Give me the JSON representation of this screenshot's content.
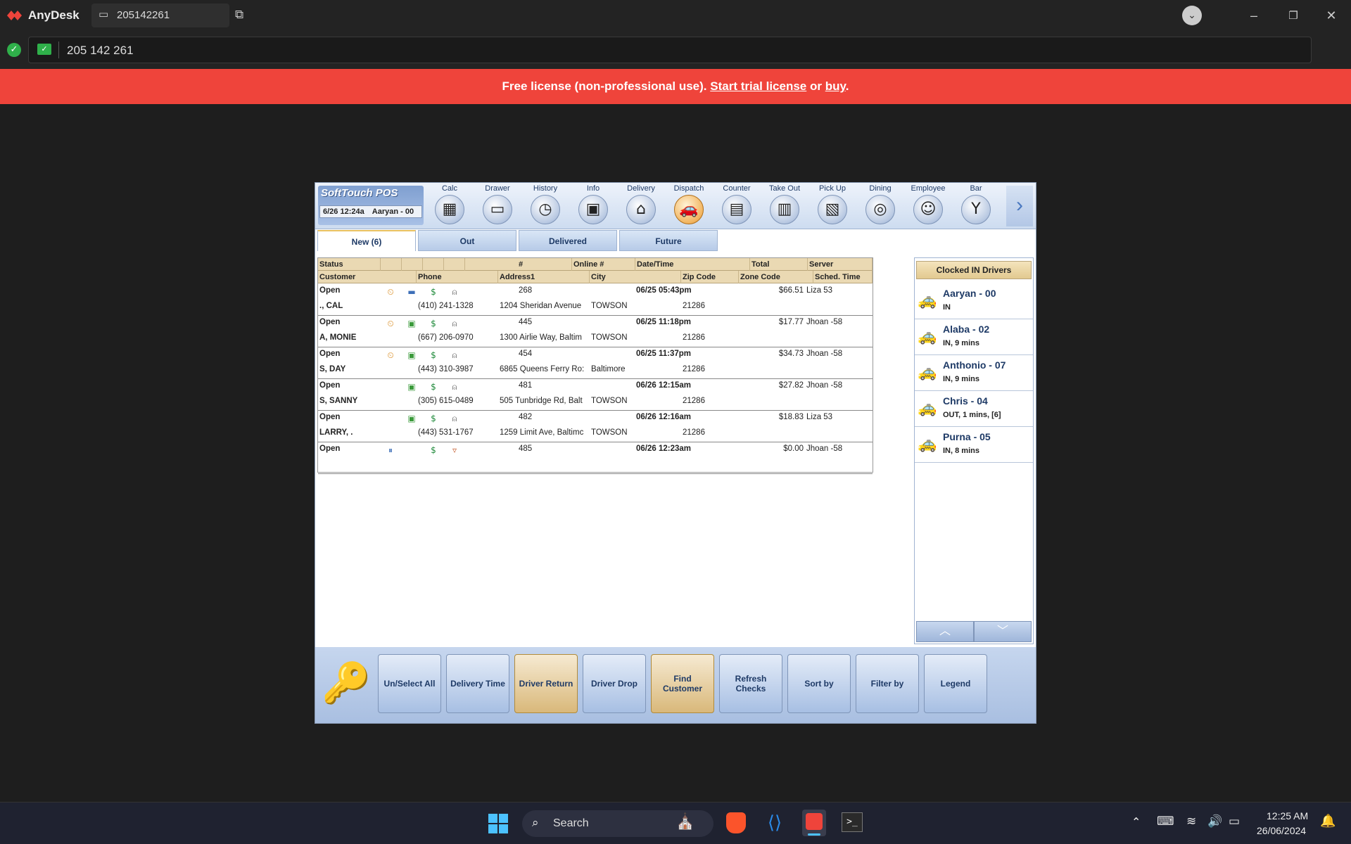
{
  "anydesk": {
    "app_name": "AnyDesk",
    "session_tab": "205142261",
    "address": "205 142 261",
    "banner_prefix": "Free license (non-professional use).",
    "banner_trial": "Start trial license",
    "banner_or": "or",
    "banner_buy": "buy",
    "banner_end": "."
  },
  "pos": {
    "brand": "SoftTouch POS",
    "datetime": "6/26 12:24a",
    "user": "Aaryan - 00",
    "nav": [
      {
        "label": "Calc",
        "icon": "calculator-icon",
        "glyph": "▦"
      },
      {
        "label": "Drawer",
        "icon": "drawer-icon",
        "glyph": "▭"
      },
      {
        "label": "History",
        "icon": "clock-icon",
        "glyph": "◷"
      },
      {
        "label": "Info",
        "icon": "chalkboard-icon",
        "glyph": "▣"
      },
      {
        "label": "Delivery",
        "icon": "house-icon",
        "glyph": "⌂"
      },
      {
        "label": "Dispatch",
        "icon": "car-icon",
        "glyph": "🚗"
      },
      {
        "label": "Counter",
        "icon": "register-icon",
        "glyph": "▤"
      },
      {
        "label": "Take Out",
        "icon": "bag-icon",
        "glyph": "▥"
      },
      {
        "label": "Pick Up",
        "icon": "map-icon",
        "glyph": "▧"
      },
      {
        "label": "Dining",
        "icon": "dining-icon",
        "glyph": "◎"
      },
      {
        "label": "Employee",
        "icon": "employee-icon",
        "glyph": "☺"
      },
      {
        "label": "Bar",
        "icon": "cocktail-icon",
        "glyph": "Y"
      }
    ],
    "tabs": [
      "New (6)",
      "Out",
      "Delivered",
      "Future"
    ],
    "headers1": [
      "Status",
      "",
      "",
      "",
      "",
      "#",
      "Online #",
      "Date/Time",
      "Total",
      "Server"
    ],
    "headers2": [
      "Customer",
      "Phone",
      "Address1",
      "City",
      "Zip Code",
      "Zone Code",
      "Sched. Time"
    ],
    "orders": [
      {
        "status": "Open",
        "num": "268",
        "datetime": "06/25 05:43pm",
        "total": "$66.51",
        "server": "Liza 53",
        "customer": "., CAL",
        "phone": "(410) 241-1328",
        "address": "1204 Sheridan Avenue",
        "city": "TOWSON",
        "zip": "21286"
      },
      {
        "status": "Open",
        "num": "445",
        "datetime": "06/25 11:18pm",
        "total": "$17.77",
        "server": "Jhoan -58",
        "customer": "A, MONIE",
        "phone": "(667) 206-0970",
        "address": "1300 Airlie Way, Baltim",
        "city": "TOWSON",
        "zip": "21286"
      },
      {
        "status": "Open",
        "num": "454",
        "datetime": "06/25 11:37pm",
        "total": "$34.73",
        "server": "Jhoan -58",
        "customer": "S, DAY",
        "phone": "(443) 310-3987",
        "address": "6865 Queens Ferry Ro:",
        "city": "Baltimore",
        "zip": "21286"
      },
      {
        "status": "Open",
        "num": "481",
        "datetime": "06/26 12:15am",
        "total": "$27.82",
        "server": "Jhoan -58",
        "customer": "S, SANNY",
        "phone": "(305) 615-0489",
        "address": "505 Tunbridge Rd, Balt",
        "city": "TOWSON",
        "zip": "21286"
      },
      {
        "status": "Open",
        "num": "482",
        "datetime": "06/26 12:16am",
        "total": "$18.83",
        "server": "Liza 53",
        "customer": "LARRY, .",
        "phone": "(443) 531-1767",
        "address": "1259 Limit Ave, Baltimc",
        "city": "TOWSON",
        "zip": "21286"
      },
      {
        "status": "Open",
        "num": "485",
        "datetime": "06/26 12:23am",
        "total": "$0.00",
        "server": "Jhoan -58",
        "customer": "",
        "phone": "",
        "address": "",
        "city": "",
        "zip": ""
      }
    ],
    "drivers_title": "Clocked IN Drivers",
    "drivers": [
      {
        "name": "Aaryan - 00",
        "status": "IN"
      },
      {
        "name": "Alaba - 02",
        "status": "IN, 9 mins"
      },
      {
        "name": "Anthonio - 07",
        "status": "IN, 9 mins"
      },
      {
        "name": "Chris - 04",
        "status": "OUT, 1 mins, [6]"
      },
      {
        "name": "Purna - 05",
        "status": "IN, 8 mins"
      }
    ],
    "buttons": [
      {
        "label": "Un/Select All"
      },
      {
        "label": "Delivery Time"
      },
      {
        "label": "Driver Return"
      },
      {
        "label": "Driver Drop"
      },
      {
        "label": "Find Customer"
      },
      {
        "label": "Refresh Checks"
      },
      {
        "label": "Sort by"
      },
      {
        "label": "Filter by"
      },
      {
        "label": "Legend"
      }
    ]
  },
  "taskbar": {
    "search": "Search",
    "time": "12:25 AM",
    "date": "26/06/2024"
  }
}
